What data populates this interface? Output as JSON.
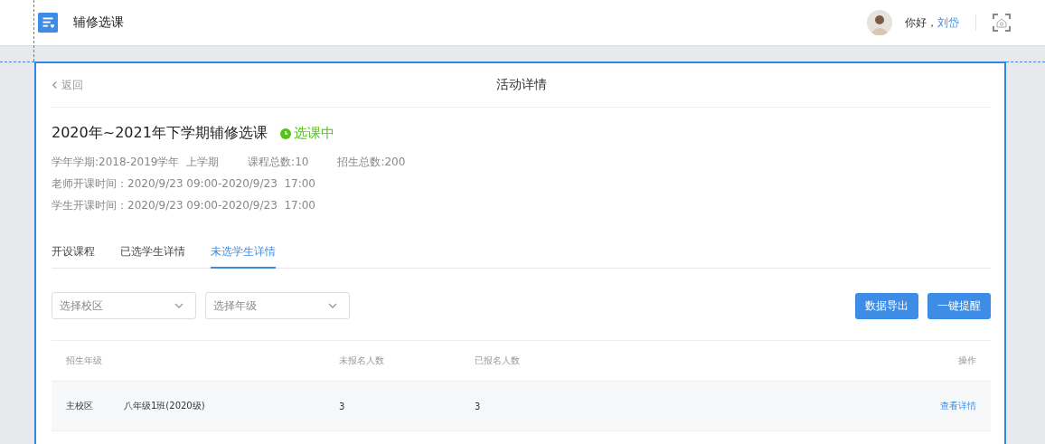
{
  "header": {
    "app_title": "辅修选课",
    "greeting": "你好，",
    "user_name": "刘岱"
  },
  "page": {
    "back": "返回",
    "title": "活动详情"
  },
  "activity": {
    "name": "2020年~2021年下学期辅修选课",
    "status": {
      "label": "选课中",
      "color": "#52c41a"
    },
    "info_row": [
      "学年学期:2018-2019学年  上学期",
      "课程总数:10",
      "招生总数:200"
    ],
    "lines": [
      "老师开课时间：2020/9/23 09:00-2020/9/23  17:00",
      "学生开课时间：2020/9/23 09:00-2020/9/23  17:00"
    ]
  },
  "tabs": [
    {
      "label": "开设课程",
      "selected": false
    },
    {
      "label": "已选学生详情",
      "selected": false
    },
    {
      "label": "未选学生详情",
      "selected": true
    }
  ],
  "filters": [
    {
      "placeholder": "选择校区"
    },
    {
      "placeholder": "选择年级"
    }
  ],
  "buttons": [
    "数据导出",
    "一键提醒"
  ],
  "table": {
    "columns": [
      "招生年级",
      "",
      "未报名人数",
      "已报名人数",
      "操作"
    ],
    "rows": [
      {
        "cells": [
          "主校区",
          "八年级1班(2020级)",
          "3",
          "3"
        ],
        "action": "查看详情"
      }
    ]
  }
}
